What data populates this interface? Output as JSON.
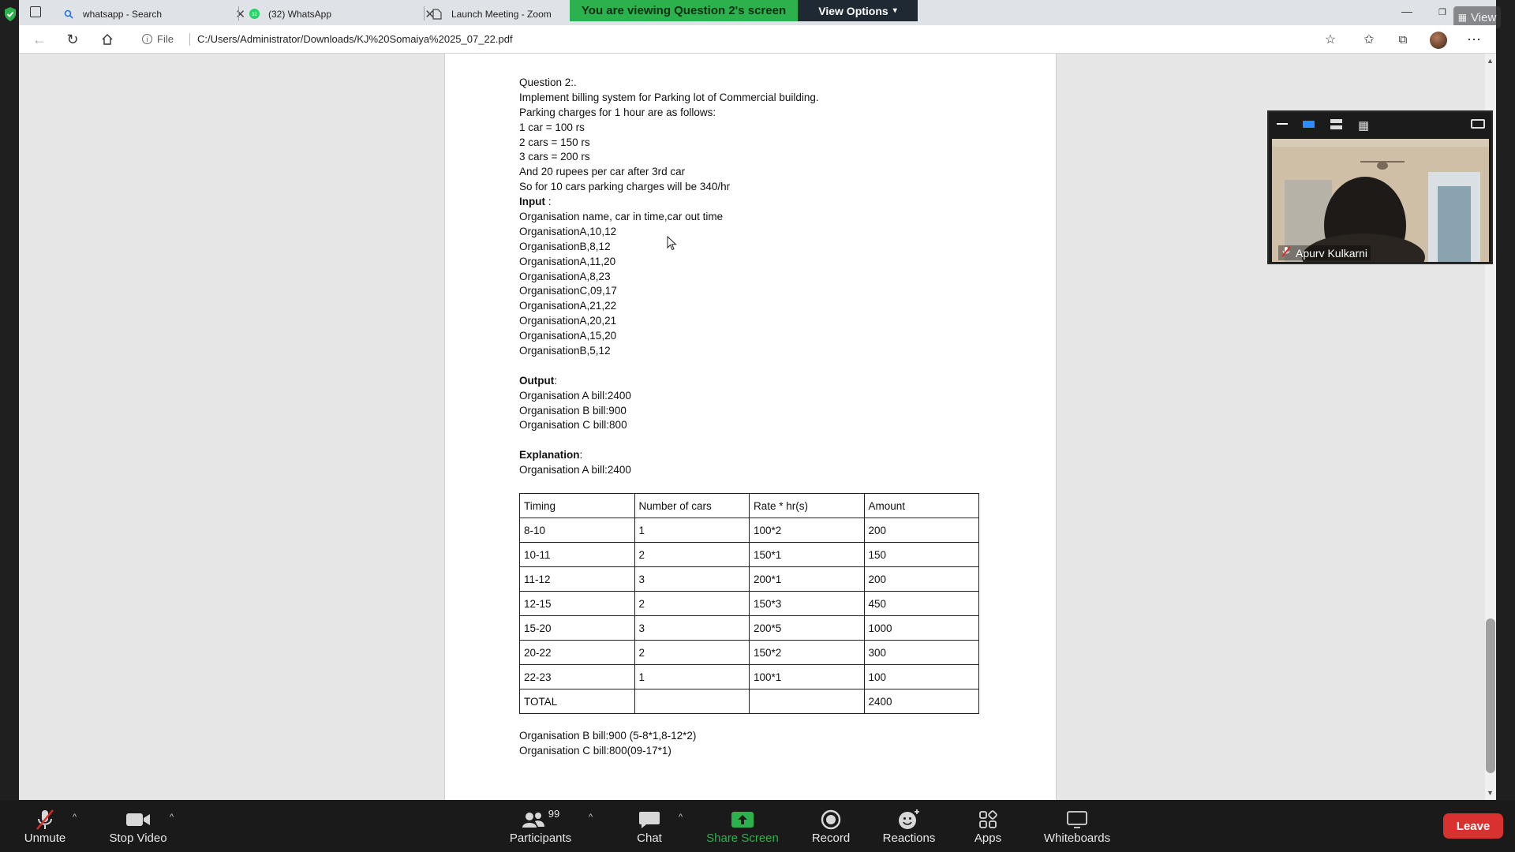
{
  "browser": {
    "tabs": [
      {
        "title": "whatsapp - Search",
        "icon": "search-icon"
      },
      {
        "title": "(32) WhatsApp",
        "icon": "whatsapp-icon"
      },
      {
        "title": "Launch Meeting - Zoom",
        "icon": "document-icon"
      }
    ],
    "address": {
      "scheme_label": "File",
      "url": "C:/Users/Administrator/Downloads/KJ%20Somaiya%2025_07_22.pdf"
    }
  },
  "zoom": {
    "banner": "You are viewing Question 2's screen",
    "view_options": "View Options",
    "view_label": "View",
    "participant_tile": {
      "name": "Apurv Kulkarni",
      "muted": true
    },
    "toolbar": {
      "unmute": "Unmute",
      "stop_video": "Stop Video",
      "participants": "Participants",
      "participants_count": "99",
      "chat": "Chat",
      "share_screen": "Share Screen",
      "record": "Record",
      "reactions": "Reactions",
      "apps": "Apps",
      "whiteboards": "Whiteboards",
      "leave": "Leave"
    },
    "colors": {
      "banner": "#2bb24c",
      "share": "#2bb24c",
      "leave": "#d9312f"
    }
  },
  "document": {
    "heading": "Question 2:.",
    "lines": [
      "Implement billing system for Parking lot of Commercial building.",
      "Parking charges for 1 hour are as follows:",
      "1 car = 100 rs",
      "2 cars = 150 rs",
      "3 cars = 200 rs",
      "And 20 rupees per car after 3rd car",
      "So for 10 cars parking charges will be 340/hr"
    ],
    "input_label": "Input",
    "input_suffix": " :",
    "input_lines": [
      "Organisation name, car in time,car out time",
      "OrganisationA,10,12",
      "OrganisationB,8,12",
      "OrganisationA,11,20",
      "OrganisationA,8,23",
      "OrganisationC,09,17",
      "OrganisationA,21,22",
      "OrganisationA,20,21",
      "OrganisationA,15,20",
      "OrganisationB,5,12"
    ],
    "output_label": "Output",
    "output_suffix": ":",
    "output_lines": [
      "Organisation A bill:2400",
      "Organisation B bill:900",
      "Organisation C bill:800"
    ],
    "explanation_label": "Explanation",
    "explanation_suffix": ":",
    "explanation_line": "Organisation A bill:2400",
    "table": {
      "headers": [
        "Timing",
        "Number of cars",
        "Rate * hr(s)",
        "Amount"
      ],
      "rows": [
        [
          "8-10",
          "1",
          "100*2",
          "200"
        ],
        [
          "10-11",
          "2",
          "150*1",
          "150"
        ],
        [
          "11-12",
          "3",
          "200*1",
          "200"
        ],
        [
          "12-15",
          "2",
          "150*3",
          "450"
        ],
        [
          "15-20",
          "3",
          "200*5",
          "1000"
        ],
        [
          "20-22",
          "2",
          "150*2",
          "300"
        ],
        [
          "22-23",
          "1",
          "100*1",
          "100"
        ],
        [
          "TOTAL",
          "",
          "",
          "2400"
        ]
      ]
    },
    "footer_lines": [
      "Organisation B bill:900 (5-8*1,8-12*2)",
      "Organisation C bill:800(09-17*1)"
    ]
  }
}
